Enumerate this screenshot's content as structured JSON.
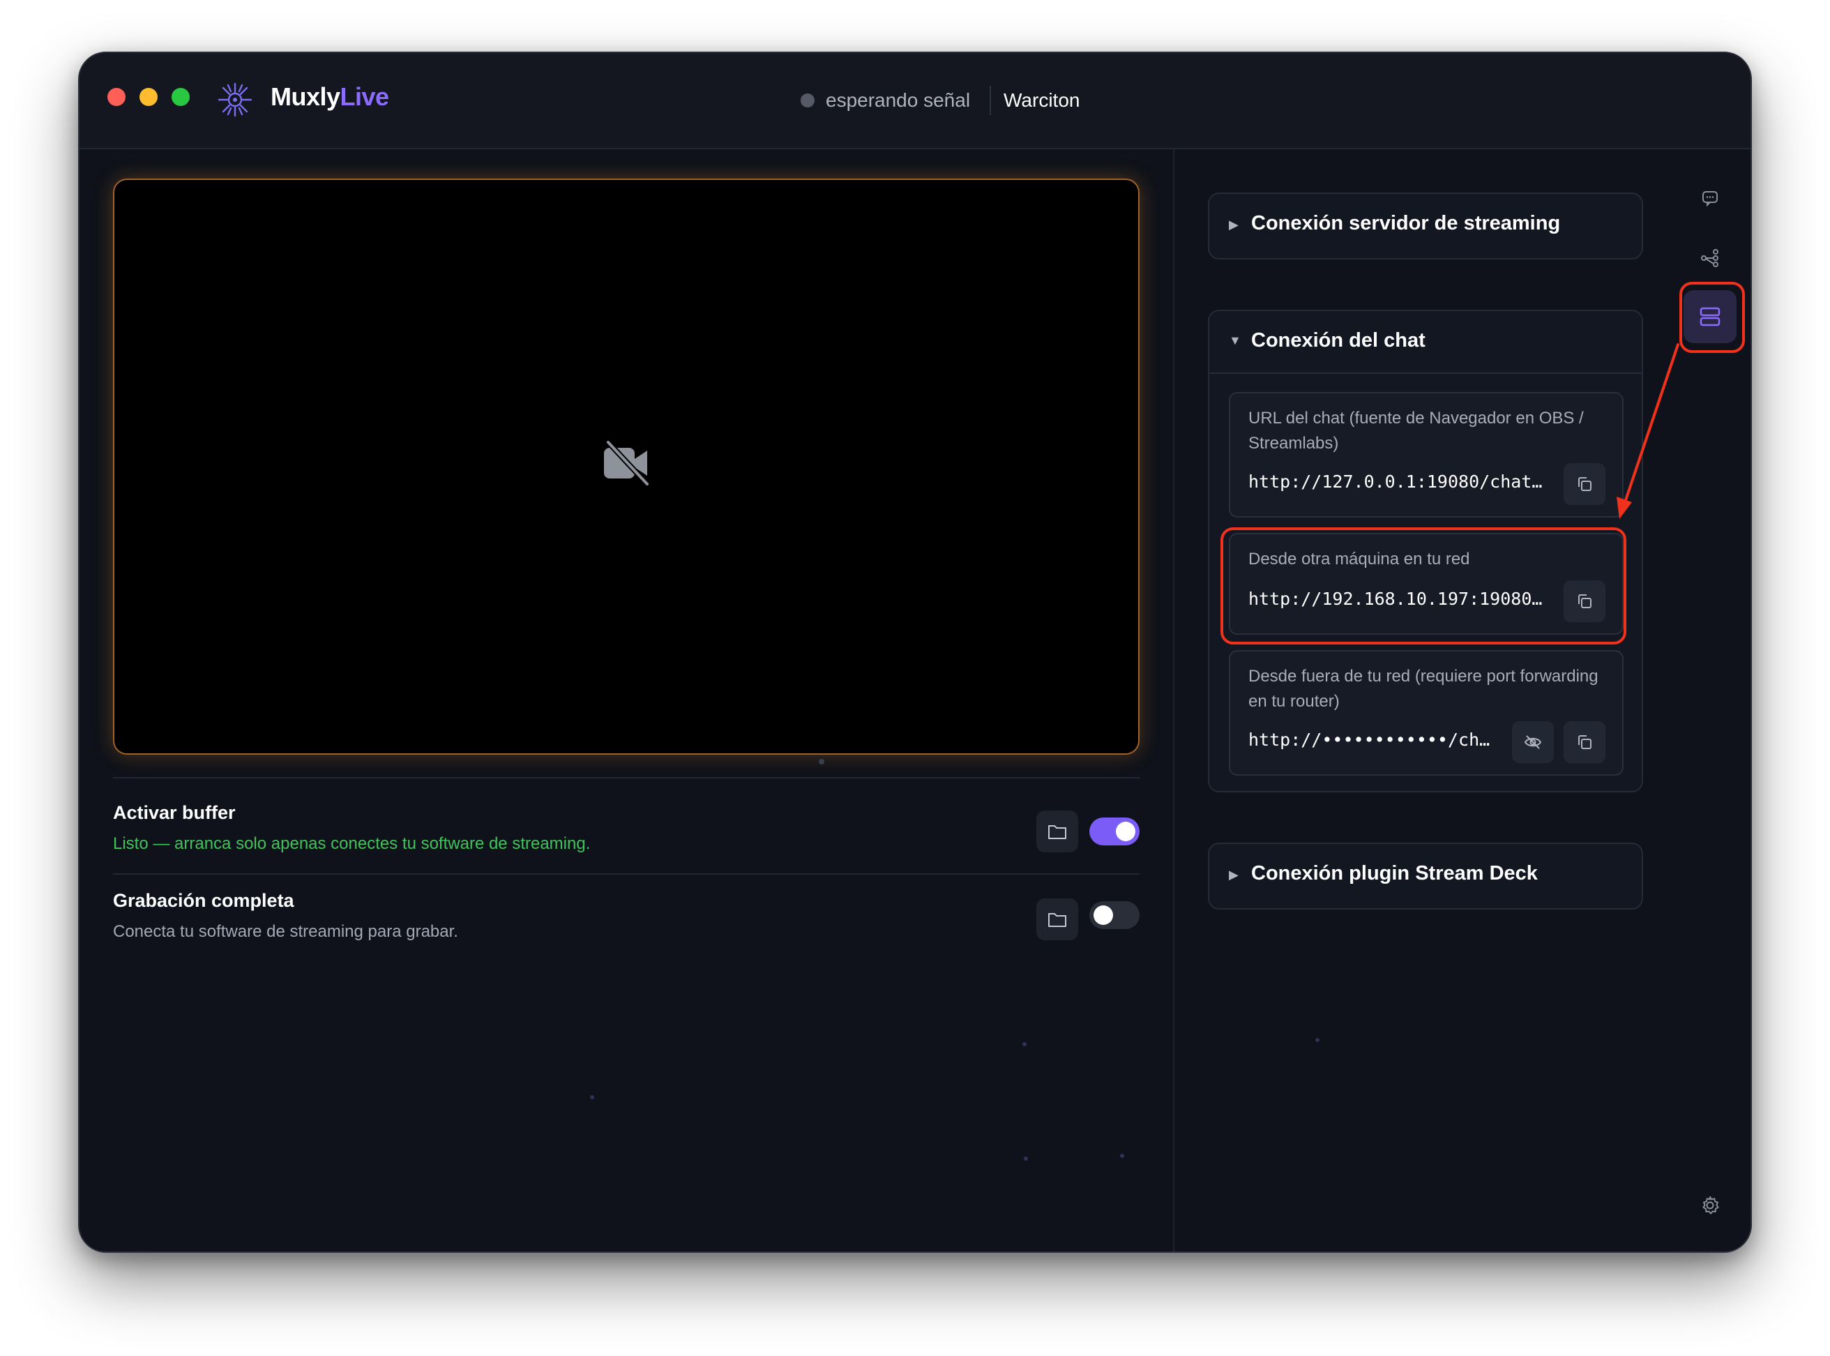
{
  "app": {
    "name_part1": "Muxly",
    "name_part2": "Live",
    "status_text": "esperando señal",
    "user": "Warciton"
  },
  "left": {
    "buffer": {
      "title": "Activar buffer",
      "subtitle": "Listo — arranca solo apenas conectes tu software de streaming.",
      "enabled": true
    },
    "recording": {
      "title": "Grabación completa",
      "subtitle": "Conecta tu software de streaming para grabar.",
      "enabled": false
    }
  },
  "right": {
    "streaming_section": {
      "title": "Conexión servidor de streaming",
      "expanded": false
    },
    "chat_section": {
      "title": "Conexión del chat",
      "expanded": true,
      "local": {
        "label": "URL del chat (fuente de Navegador en OBS / Streamlabs)",
        "url": "http://127.0.0.1:19080/chat…"
      },
      "lan": {
        "label": "Desde otra máquina en tu red",
        "url": "http://192.168.10.197:19080…"
      },
      "wan": {
        "label": "Desde fuera de tu red (requiere port forwarding en tu router)",
        "url": "http://••••••••••••/ch…"
      }
    },
    "streamdeck_section": {
      "title": "Conexión plugin Stream Deck",
      "expanded": false
    }
  },
  "icons": {
    "rail": [
      "chat-bubble-icon",
      "network-icon",
      "server-icon",
      "settings-icon"
    ],
    "accent": "#8b6cff",
    "highlight": "#f0311b"
  }
}
